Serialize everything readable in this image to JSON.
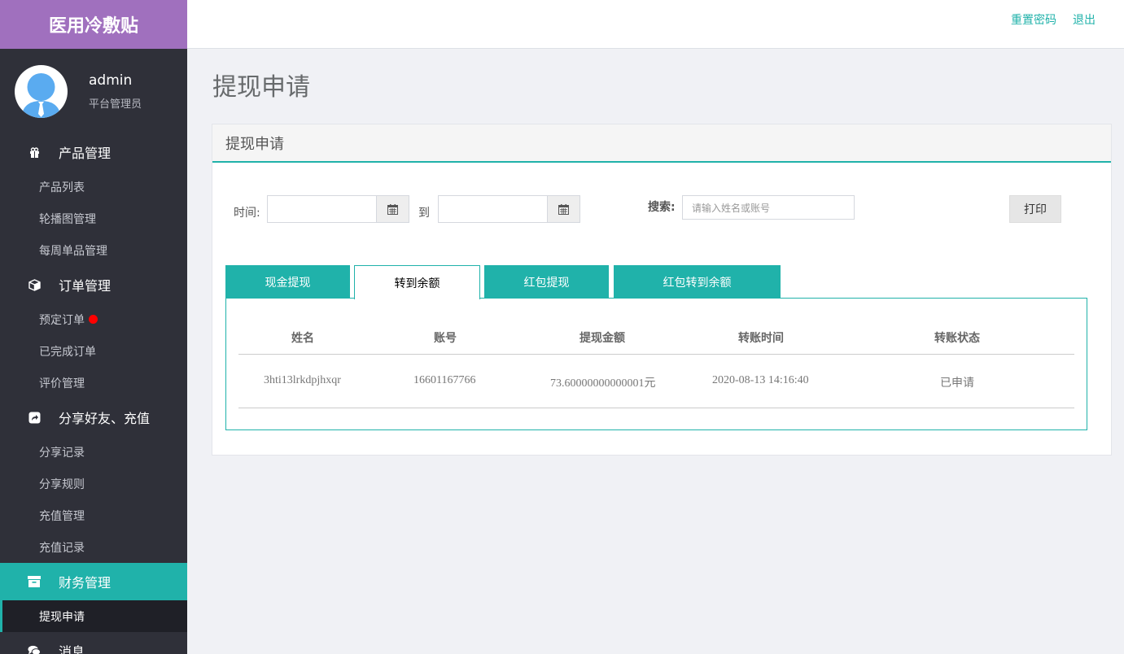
{
  "brand": "医用冷敷贴",
  "profile": {
    "name": "admin",
    "role": "平台管理员"
  },
  "sidebar": {
    "product": {
      "label": "产品管理",
      "icon": "gift-icon",
      "items": [
        "产品列表",
        "轮播图管理",
        "每周单品管理"
      ]
    },
    "order": {
      "label": "订单管理",
      "icon": "cube-icon",
      "items": [
        "预定订单",
        "已完成订单",
        "评价管理"
      ]
    },
    "share": {
      "label": "分享好友、充值",
      "icon": "share-icon",
      "items": [
        "分享记录",
        "分享规则",
        "充值管理",
        "充值记录"
      ]
    },
    "finance": {
      "label": "财务管理",
      "icon": "archive-icon",
      "items": [
        "提现申请"
      ]
    },
    "message": {
      "label": "消息",
      "icon": "comments-icon"
    }
  },
  "topbar": {
    "reset_password": "重置密码",
    "logout": "退出"
  },
  "page": {
    "title": "提现申请",
    "panel_title": "提现申请"
  },
  "filters": {
    "time_label": "时间:",
    "to_label": "到",
    "search_label": "搜索:",
    "search_placeholder": "请输入姓名或账号",
    "print_label": "打印"
  },
  "tabs": [
    {
      "label": "现金提现",
      "active": false
    },
    {
      "label": "转到余额",
      "active": true
    },
    {
      "label": "红包提现",
      "active": false
    },
    {
      "label": "红包转到余额",
      "active": false
    }
  ],
  "table": {
    "headers": [
      "姓名",
      "账号",
      "提现金额",
      "转账时间",
      "转账状态"
    ],
    "rows": [
      [
        "3hti13lrkdpjhxqr",
        "16601167766",
        "73.60000000000001元",
        "2020-08-13 14:16:40",
        "已申请"
      ]
    ]
  },
  "colors": {
    "accent": "#20b2aa",
    "brand": "#a070be",
    "sidebar": "#2f3039",
    "alert_dot": "#ff0000"
  }
}
